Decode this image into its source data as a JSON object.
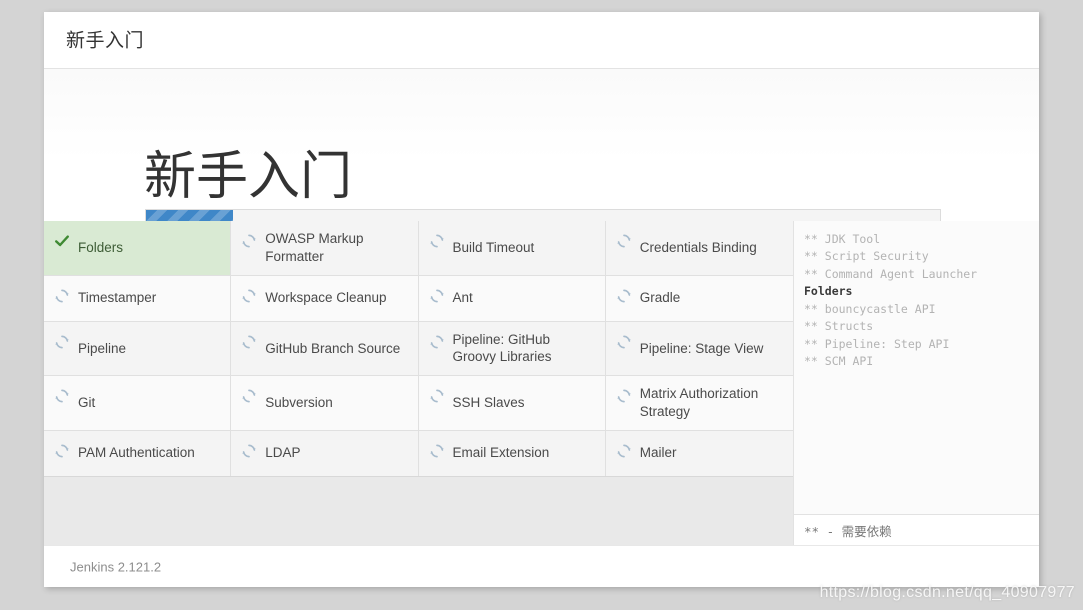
{
  "colors": {
    "page_background": "#d4d4d4",
    "card_background": "#ffffff",
    "progress_fill": "#3f87c8",
    "done_row": "#d9ead3",
    "spinner": "#a8bccd",
    "check": "#3f8a33"
  },
  "topbar": {
    "title": "新手入门"
  },
  "hero": {
    "heading": "新手入门"
  },
  "progress": {
    "percent": 11,
    "label": "11%"
  },
  "plugins": {
    "rows": [
      [
        {
          "label": "Folders",
          "status": "done",
          "icon": "check-icon"
        },
        {
          "label": "OWASP Markup Formatter",
          "status": "pending",
          "icon": "spinner-icon"
        },
        {
          "label": "Build Timeout",
          "status": "pending",
          "icon": "spinner-icon"
        },
        {
          "label": "Credentials Binding",
          "status": "pending",
          "icon": "spinner-icon"
        }
      ],
      [
        {
          "label": "Timestamper",
          "status": "pending",
          "icon": "spinner-icon"
        },
        {
          "label": "Workspace Cleanup",
          "status": "pending",
          "icon": "spinner-icon"
        },
        {
          "label": "Ant",
          "status": "pending",
          "icon": "spinner-icon"
        },
        {
          "label": "Gradle",
          "status": "pending",
          "icon": "spinner-icon"
        }
      ],
      [
        {
          "label": "Pipeline",
          "status": "pending",
          "icon": "spinner-icon"
        },
        {
          "label": "GitHub Branch Source",
          "status": "pending",
          "icon": "spinner-icon"
        },
        {
          "label": "Pipeline: GitHub Groovy Libraries",
          "status": "pending",
          "icon": "spinner-icon"
        },
        {
          "label": "Pipeline: Stage View",
          "status": "pending",
          "icon": "spinner-icon"
        }
      ],
      [
        {
          "label": "Git",
          "status": "pending",
          "icon": "spinner-icon"
        },
        {
          "label": "Subversion",
          "status": "pending",
          "icon": "spinner-icon"
        },
        {
          "label": "SSH Slaves",
          "status": "pending",
          "icon": "spinner-icon"
        },
        {
          "label": "Matrix Authorization Strategy",
          "status": "pending",
          "icon": "spinner-icon"
        }
      ],
      [
        {
          "label": "PAM Authentication",
          "status": "pending",
          "icon": "spinner-icon"
        },
        {
          "label": "LDAP",
          "status": "pending",
          "icon": "spinner-icon"
        },
        {
          "label": "Email Extension",
          "status": "pending",
          "icon": "spinner-icon"
        },
        {
          "label": "Mailer",
          "status": "pending",
          "icon": "spinner-icon"
        }
      ]
    ]
  },
  "log": {
    "lines": [
      {
        "text": "** JDK Tool",
        "current": false
      },
      {
        "text": "** Script Security",
        "current": false
      },
      {
        "text": "** Command Agent Launcher",
        "current": false
      },
      {
        "text": "Folders",
        "current": true
      },
      {
        "text": "** bouncycastle API",
        "current": false
      },
      {
        "text": "** Structs",
        "current": false
      },
      {
        "text": "** Pipeline: Step API",
        "current": false
      },
      {
        "text": "** SCM API",
        "current": false
      }
    ],
    "footnote": "** - 需要依赖"
  },
  "footer": {
    "version": "Jenkins 2.121.2"
  },
  "watermark": {
    "text": "https://blog.csdn.net/qq_40907977"
  }
}
